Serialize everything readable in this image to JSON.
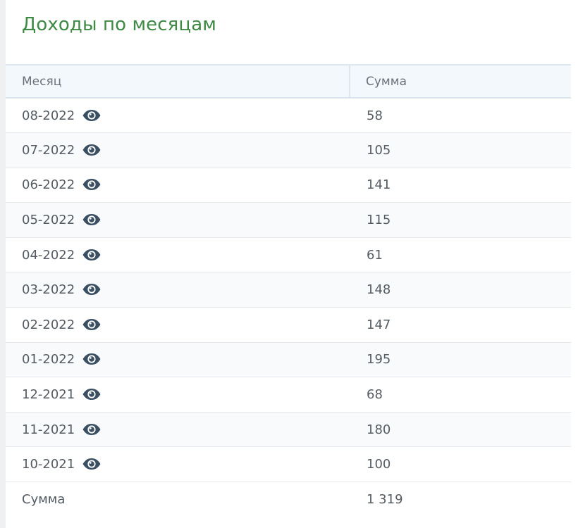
{
  "page": {
    "title": "Доходы по месяцам"
  },
  "table": {
    "headers": {
      "month": "Месяц",
      "sum": "Сумма"
    },
    "rows": [
      {
        "month": "08-2022",
        "sum": "58",
        "icon": "eye-icon"
      },
      {
        "month": "07-2022",
        "sum": "105",
        "icon": "eye-icon"
      },
      {
        "month": "06-2022",
        "sum": "141",
        "icon": "eye-icon"
      },
      {
        "month": "05-2022",
        "sum": "115",
        "icon": "eye-icon"
      },
      {
        "month": "04-2022",
        "sum": "61",
        "icon": "eye-icon"
      },
      {
        "month": "03-2022",
        "sum": "148",
        "icon": "eye-icon"
      },
      {
        "month": "02-2022",
        "sum": "147",
        "icon": "eye-icon"
      },
      {
        "month": "01-2022",
        "sum": "195",
        "icon": "eye-icon"
      },
      {
        "month": "12-2021",
        "sum": "68",
        "icon": "eye-icon"
      },
      {
        "month": "11-2021",
        "sum": "180",
        "icon": "eye-icon"
      },
      {
        "month": "10-2021",
        "sum": "100",
        "icon": "eye-icon"
      }
    ],
    "footer": {
      "label": "Сумма",
      "total": "1 319"
    }
  },
  "colors": {
    "title": "#3e8a45",
    "text": "#555c63",
    "header_bg": "#f3f8fd",
    "icon": "#3b4f63"
  }
}
